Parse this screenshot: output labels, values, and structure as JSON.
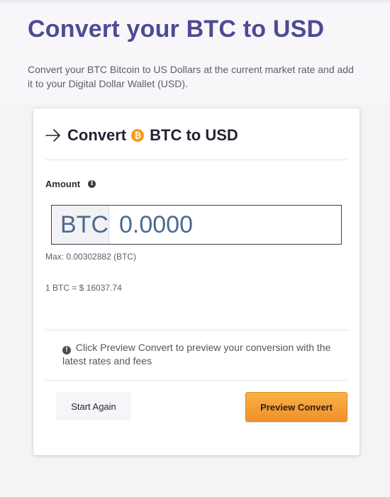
{
  "header": {
    "title": "Convert your BTC to USD",
    "description": "Convert your BTC Bitcoin to US Dollars at the current market rate and add it to your Digital Dollar Wallet (USD)."
  },
  "card": {
    "title_prefix": "Convert",
    "title_suffix": "BTC to USD",
    "btc_icon_glyph": "₿",
    "amount_label": "Amount",
    "currency_prefix": "BTC",
    "amount_placeholder": "0.0000",
    "max_text": "Max: 0.00302882 (BTC)",
    "rate_text": "1 BTC = $ 16037.74",
    "notice": "Click Preview Convert to preview your conversion with the latest rates and fees",
    "start_again_label": "Start Again",
    "preview_label": "Preview Convert"
  },
  "icons": {
    "arrow": "arrow-right-icon",
    "bitcoin": "bitcoin-icon",
    "info": "info-icon",
    "notice": "exclamation-circle-icon"
  },
  "colors": {
    "title": "#4c4b95",
    "amount_text": "#4b6a93",
    "bitcoin": "#f39a1e",
    "preview_button": "#f39b2a"
  }
}
